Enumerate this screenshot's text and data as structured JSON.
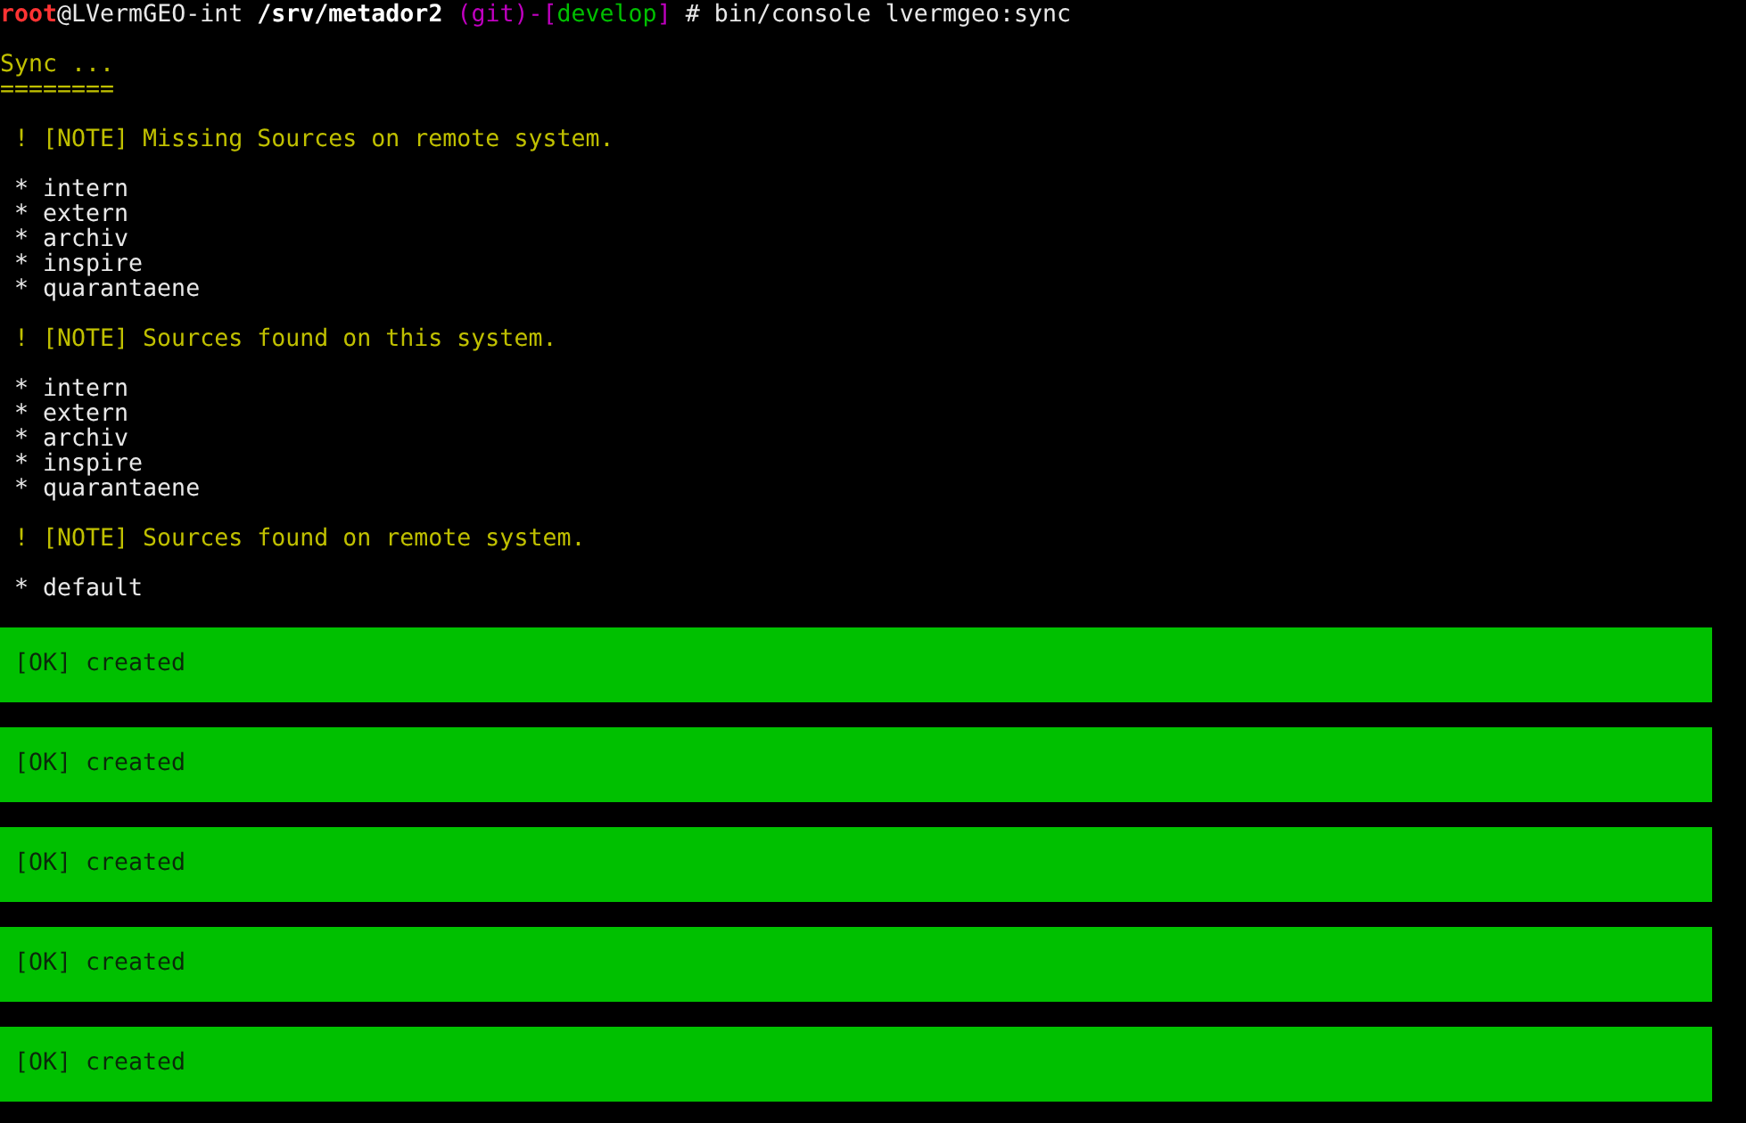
{
  "prompt": {
    "segments": [
      {
        "kind": "user",
        "text": "root"
      },
      {
        "kind": "host",
        "text": "@LVermGEO-int"
      },
      {
        "kind": "path",
        "text": "/srv/metador2"
      },
      {
        "kind": "vcs",
        "text": "(git)-["
      },
      {
        "kind": "branch",
        "text": "develop"
      },
      {
        "kind": "vcs_end",
        "text": "]"
      },
      {
        "kind": "command",
        "text": "# bin/console lvermgeo:sync"
      }
    ]
  },
  "output": [
    {
      "kind": "title",
      "text": "Sync ..."
    },
    {
      "kind": "underline",
      "text": "========"
    },
    {
      "kind": "note",
      "text": "! [NOTE] Missing Sources on remote system."
    },
    {
      "kind": "item",
      "text": "* intern"
    },
    {
      "kind": "item",
      "text": "* extern"
    },
    {
      "kind": "item",
      "text": "* archiv"
    },
    {
      "kind": "item",
      "text": "* inspire"
    },
    {
      "kind": "item",
      "text": "* quarantaene"
    },
    {
      "kind": "note",
      "text": "! [NOTE] Sources found on this system."
    },
    {
      "kind": "item",
      "text": "* intern"
    },
    {
      "kind": "item",
      "text": "* extern"
    },
    {
      "kind": "item",
      "text": "* archiv"
    },
    {
      "kind": "item",
      "text": "* inspire"
    },
    {
      "kind": "item",
      "text": "* quarantaene"
    },
    {
      "kind": "note",
      "text": "! [NOTE] Sources found on remote system."
    },
    {
      "kind": "item",
      "text": "* default"
    },
    {
      "kind": "success",
      "text": "[OK] created"
    },
    {
      "kind": "success",
      "text": "[OK] created"
    },
    {
      "kind": "success",
      "text": "[OK] created"
    },
    {
      "kind": "success",
      "text": "[OK] created"
    },
    {
      "kind": "success",
      "text": "[OK] created"
    }
  ]
}
